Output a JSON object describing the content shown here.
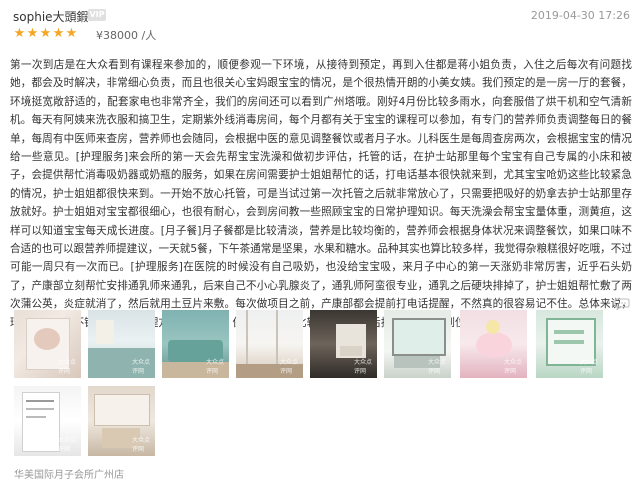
{
  "review": {
    "username": "sophie大頭鍜",
    "vip_badge": "VIP",
    "date": "2019-04-30 17:26",
    "rating_stars": 5,
    "price": "¥38000 /人",
    "body": "第一次到店是在大众看到有课程来参加的，顺便参观一下环境，从接待到预定，再到入住都是蒋小姐负责，入住之后每次有问题找她，都会及时解决，非常细心负责，而且也很关心宝妈跟宝宝的情况，是个很热情开朗的小美女姨。我们预定的是一房一厅的套餐，环境挺宽敞舒适的，配套家电也非常齐全，我们的房间还可以看到广州塔哦。刚好4月份比较多雨水，向套服借了烘干机和空气清新机。每天有阿姨来洗衣服和搞卫生，定期紫外线消毒房间，每个月都有关于宝宝的课程可以参加，有专门的营养师负责调整每日的餐单，每周有中医师来查房，营养师也会随同，会根据中医的意见调整餐饮或者月子水。儿科医生是每周查房两次，会根据宝宝的情况给一些意见。[护理服务]来会所的第一天会先帮宝宝洗澡和做初步评估，托管的话，在护士站那里每个宝宝有自己专属的小床和被子，会提供帮忙消毒吸奶器或奶瓶的服务，如果在房间需要护士姐姐帮忙的话，打电话基本很快就来到，尤其宝宝呛奶这些比较紧急的情况，护士姐姐都很快来到。一开始不放心托管，可是当试过第一次托管之后就非常放心了，只需要把吸好的奶拿去护士站那里存放就好。护士姐姐对宝宝都很细心，也很有耐心，会到房间教一些照顾宝宝的日常护理知识。每天洗澡会帮宝宝量体重，测黄疸，这样可以知道宝宝每天成长进度。[月子餐]月子餐都是比较清淡，营养是比较均衡的，营养师会根据身体状况来调整餐饮，如果口味不合适的也可以跟营养师提建议，一天就5餐，下午茶通常是坚果，水果和糖水。品种其实也算比较多样，我觉得杂粮糕很好吃哦，不过可能一周只有一次而已。[护理服务]在医院的时候没有自己吸奶，也没给宝宝吸，来月子中心的第一天涨奶非常厉害，近乎石头奶了，产康部立刻帮忙安排通乳师来通乳，后来自己不小心乳腺炎了，通乳师阿蛮很专业，通乳之后硬块排掉了，护士姐姐帮忙敷了两次蒲公英，炎症就消了，然后就用土豆片来敷。每次做项目之前，产康部都会提前打电话提醒，不然真的很容易记不住。总体来说，环境还是比较不错的，护士护理方面也很专业，保洁阿姨也是比较勤快的。产后护理方面也很到位。",
    "photo_watermark": "大众点评网",
    "shop_name": "华美国际月子会所广州店",
    "icons": {
      "star": "star-icon",
      "comment": "comment-icon"
    },
    "colors": {
      "star": "#f5a623",
      "vip_badge": "#e0e0e0",
      "meta_text": "#999999"
    }
  }
}
